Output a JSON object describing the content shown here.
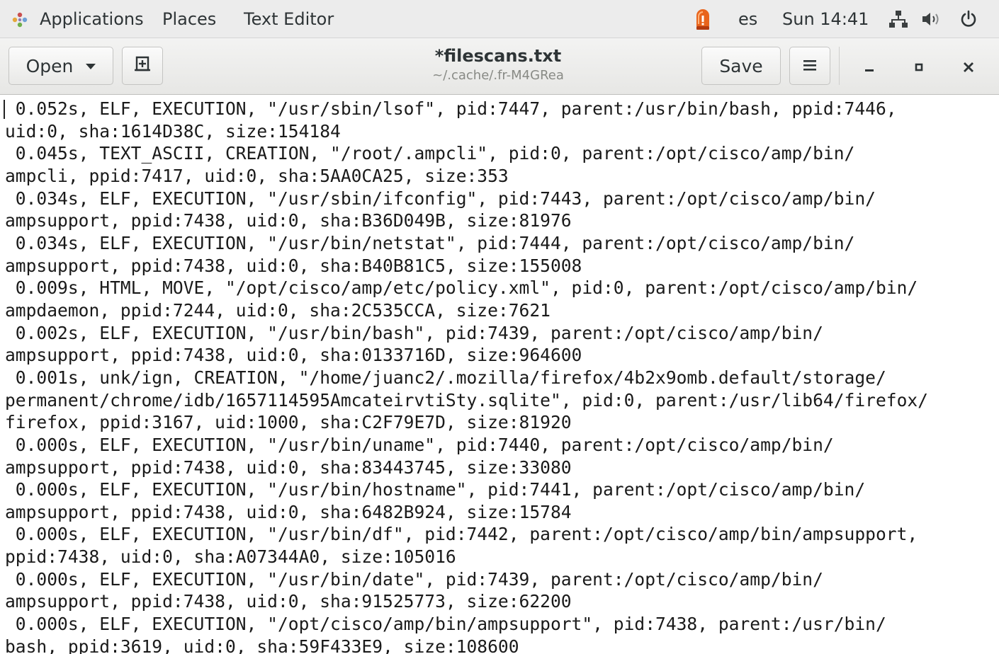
{
  "top_panel": {
    "applications_label": "Applications",
    "places_label": "Places",
    "app_menu_label": "Text Editor",
    "keyboard_layout": "es",
    "clock": "Sun 14:41",
    "icons": [
      "applications-icon",
      "alert-icon",
      "network-icon",
      "volume-icon",
      "power-icon"
    ]
  },
  "header_bar": {
    "open_label": "Open",
    "save_label": "Save",
    "title": "*filescans.txt",
    "subtitle": "~/.cache/.fr-M4GRea",
    "icons": [
      "new-document-icon",
      "hamburger-menu-icon",
      "minimize-icon",
      "maximize-icon",
      "close-icon"
    ]
  },
  "document": {
    "lines": [
      " 0.052s, ELF, EXECUTION, \"/usr/sbin/lsof\", pid:7447, parent:/usr/bin/bash, ppid:7446,",
      "uid:0, sha:1614D38C, size:154184",
      " 0.045s, TEXT_ASCII, CREATION, \"/root/.ampcli\", pid:0, parent:/opt/cisco/amp/bin/",
      "ampcli, ppid:7417, uid:0, sha:5AA0CA25, size:353",
      " 0.034s, ELF, EXECUTION, \"/usr/sbin/ifconfig\", pid:7443, parent:/opt/cisco/amp/bin/",
      "ampsupport, ppid:7438, uid:0, sha:B36D049B, size:81976",
      " 0.034s, ELF, EXECUTION, \"/usr/bin/netstat\", pid:7444, parent:/opt/cisco/amp/bin/",
      "ampsupport, ppid:7438, uid:0, sha:B40B81C5, size:155008",
      " 0.009s, HTML, MOVE, \"/opt/cisco/amp/etc/policy.xml\", pid:0, parent:/opt/cisco/amp/bin/",
      "ampdaemon, ppid:7244, uid:0, sha:2C535CCA, size:7621",
      " 0.002s, ELF, EXECUTION, \"/usr/bin/bash\", pid:7439, parent:/opt/cisco/amp/bin/",
      "ampsupport, ppid:7438, uid:0, sha:0133716D, size:964600",
      " 0.001s, unk/ign, CREATION, \"/home/juanc2/.mozilla/firefox/4b2x9omb.default/storage/",
      "permanent/chrome/idb/1657114595AmcateirvtiSty.sqlite\", pid:0, parent:/usr/lib64/firefox/",
      "firefox, ppid:3167, uid:1000, sha:C2F79E7D, size:81920",
      " 0.000s, ELF, EXECUTION, \"/usr/bin/uname\", pid:7440, parent:/opt/cisco/amp/bin/",
      "ampsupport, ppid:7438, uid:0, sha:83443745, size:33080",
      " 0.000s, ELF, EXECUTION, \"/usr/bin/hostname\", pid:7441, parent:/opt/cisco/amp/bin/",
      "ampsupport, ppid:7438, uid:0, sha:6482B924, size:15784",
      " 0.000s, ELF, EXECUTION, \"/usr/bin/df\", pid:7442, parent:/opt/cisco/amp/bin/ampsupport,",
      "ppid:7438, uid:0, sha:A07344A0, size:105016",
      " 0.000s, ELF, EXECUTION, \"/usr/bin/date\", pid:7439, parent:/opt/cisco/amp/bin/",
      "ampsupport, ppid:7438, uid:0, sha:91525773, size:62200",
      " 0.000s, ELF, EXECUTION, \"/opt/cisco/amp/bin/ampsupport\", pid:7438, parent:/usr/bin/",
      "bash, ppid:3619, uid:0, sha:59F433E9, size:108600"
    ]
  },
  "colors": {
    "panel_bg": "#ececec",
    "headerbar_bg": "#e7e7e5",
    "text": "#1a1a1a",
    "alert_orange": "#e8641c"
  }
}
